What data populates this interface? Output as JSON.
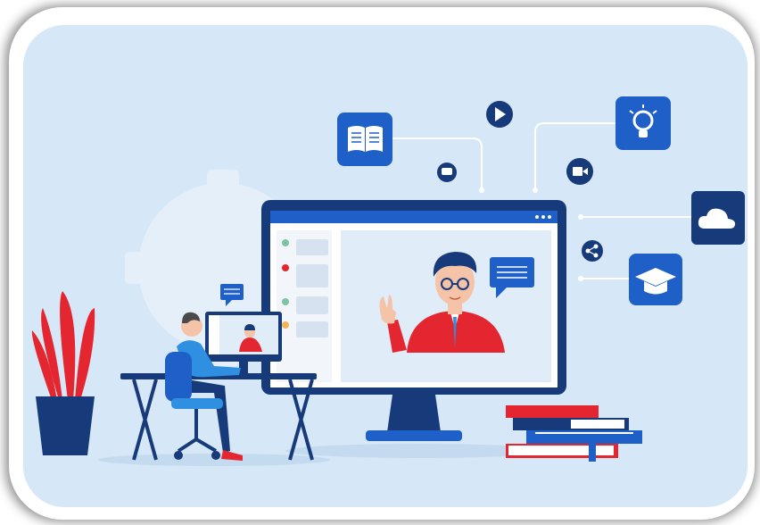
{
  "scene": {
    "description_free": true,
    "colors": {
      "background_panel": "#d6e8f7",
      "frame_white": "#ffffff",
      "frame_shadow": "#9a9a9a",
      "navy": "#173a7a",
      "blue": "#1e5fc8",
      "light_blue": "#2f8fe0",
      "red": "#e3262f",
      "skin": "#f4c3a8",
      "gear": "#e6f0fa"
    },
    "icons": [
      "open-book-icon",
      "play-icon",
      "lightbulb-icon",
      "chat-bubble-icon",
      "video-camera-icon",
      "cloud-icon",
      "share-icon",
      "graduation-cap-icon"
    ]
  }
}
